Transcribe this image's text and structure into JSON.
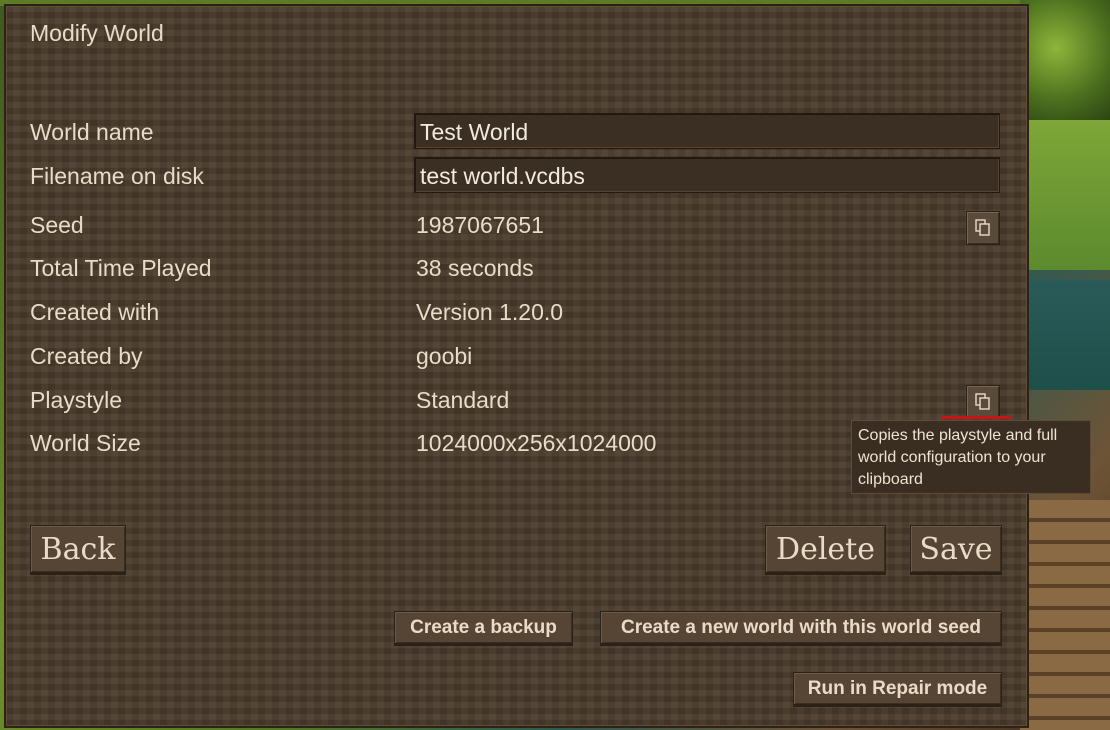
{
  "dialog": {
    "title": "Modify World"
  },
  "fields": {
    "world_name": {
      "label": "World name",
      "value": "Test World"
    },
    "filename": {
      "label": "Filename on disk",
      "value": "test world.vcdbs"
    }
  },
  "info": {
    "seed": {
      "label": "Seed",
      "value": "1987067651"
    },
    "time_played": {
      "label": "Total Time Played",
      "value": "38 seconds"
    },
    "created_with": {
      "label": "Created with",
      "value": "Version 1.20.0"
    },
    "created_by": {
      "label": "Created by",
      "value": "goobi"
    },
    "playstyle": {
      "label": "Playstyle",
      "value": "Standard"
    },
    "world_size": {
      "label": "World Size",
      "value": "1024000x256x1024000"
    }
  },
  "tooltip": {
    "text": "Copies the playstyle and full world configuration to your clipboard"
  },
  "buttons": {
    "back": "Back",
    "delete": "Delete",
    "save": "Save",
    "backup": "Create a backup",
    "new_world_seed": "Create a new world with this world seed",
    "repair": "Run in Repair mode"
  },
  "icons": {
    "copy": "copy-icon"
  },
  "colors": {
    "panel": "#4a3b2b",
    "text": "#e8dcc8",
    "highlight": "#c81414"
  }
}
